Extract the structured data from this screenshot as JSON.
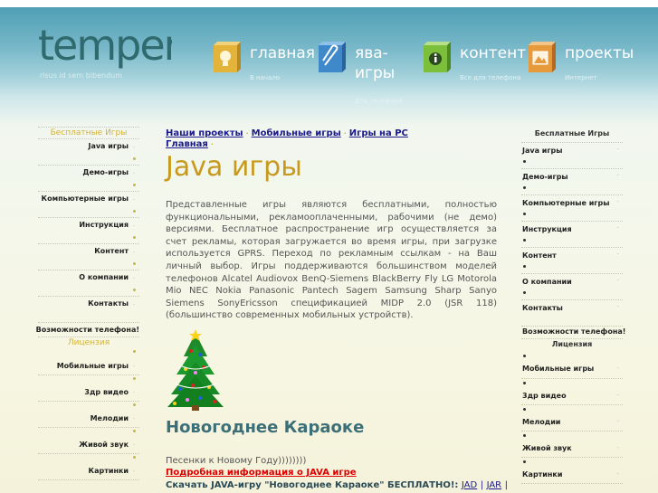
{
  "logo": {
    "text": "temper",
    "tagline": "risus id sem bibendum"
  },
  "colors": {
    "accent": "#c79a1e",
    "link": "#1a1a8c",
    "alert": "#e00000",
    "header": "#5fa7bb"
  },
  "nav": [
    {
      "label": "главная",
      "sub": "В начало",
      "icon": "lightbulb-icon",
      "color": "#e3b33a"
    },
    {
      "label": "ява-",
      "label2": "игры",
      "sub": "Для телефона",
      "icon": "paperclip-icon",
      "color": "#3f88c9"
    },
    {
      "label": "контент",
      "sub": "Все для телефона",
      "icon": "info-icon",
      "color": "#7bbf3a"
    },
    {
      "label": "проекты",
      "sub": "Интернет",
      "icon": "picture-icon",
      "color": "#e79a3c"
    }
  ],
  "left_menu": {
    "heading": "Бесплатные Игры",
    "items_top": [
      "Java игры",
      "Демо-игры",
      "Компьютерные игры",
      "Инструкция",
      "Контент",
      "О компании",
      "Контакты",
      "Возможности телефона!"
    ],
    "subheading": "Лицензия",
    "items_bottom": [
      "Мобильные игры",
      "3др видео",
      "Мелодии",
      "Живой звук",
      "Картинки"
    ]
  },
  "right_menu": {
    "heading": "Бесплатные Игры",
    "items_top": [
      "Java игры",
      "Демо-игры",
      "Компьютерные игры",
      "Инструкция",
      "Контент",
      "О компании",
      "Контакты",
      "Возможности телефона!"
    ],
    "subheading": "Лицензия",
    "items_bottom": [
      "Мобильные игры",
      "3др видео",
      "Мелодии",
      "Живой звук",
      "Картинки"
    ]
  },
  "breadcrumb": [
    "Наши проекты",
    "Мобильные игры",
    "Игры на PC",
    "Главная"
  ],
  "main": {
    "title": "Java игры",
    "description": "Представленные игры являются бесплатными, полностью функциональными, рекламооплаченными, рабочими (не демо) версиями. Бесплатное распространение игр осуществляется за счет рекламы, которая загружается во время игры, при загрузке используется GPRS. Переход по рекламным ссылкам - на Ваш личный выбор. Игры поддерживаются большинством моделей телефонов Alcatel Audiovox BenQ-Siemens BlackBerry Fly LG Motorola Mio NEC Nokia Panasonic Pantech Sagem Samsung Sharp Sanyo Siemens SonyEricsson спецификацией MIDP 2.0 (JSR 118) (большинство современных мобильных устройств).",
    "section_title": "Новогоднее Караоке",
    "song_text": "Песенки к Новому Году))))))))",
    "info_link": "Подробная информация о JAVA игре",
    "download_label": "Скачать JAVA-игру \"Новогоднее Караоке\" БЕСПЛАТНО!:",
    "download_jad": "JAD",
    "download_jar": "JAR",
    "pipe": "|"
  }
}
